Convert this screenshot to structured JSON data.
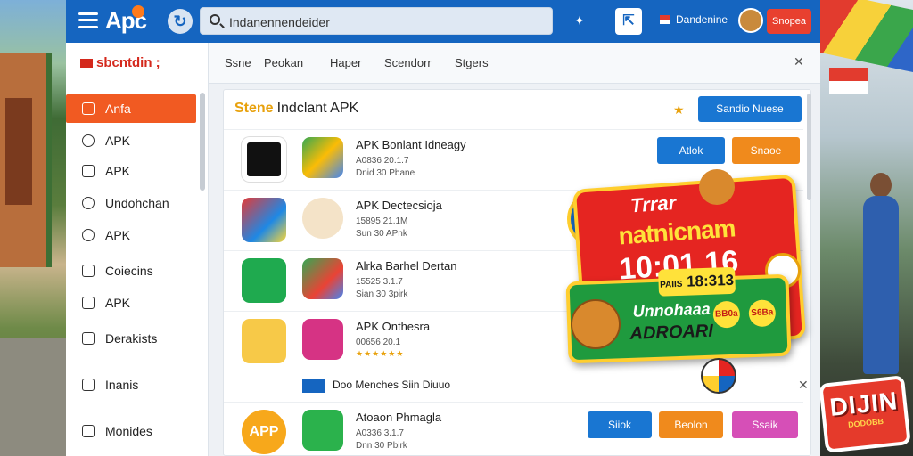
{
  "header": {
    "logo": "Apc",
    "search_text": "Indanennendeider",
    "user_name": "Dandenine",
    "signup_label": "Snopea"
  },
  "sidebar": {
    "brand": "sbcntdin",
    "brand_suffix": ";",
    "items": [
      {
        "label": "Anfa",
        "icon": "grid-icon",
        "active": true
      },
      {
        "label": "APK",
        "icon": "clock-icon"
      },
      {
        "label": "APK",
        "icon": "home-icon"
      },
      {
        "label": "Undohchan",
        "icon": "shield-icon"
      },
      {
        "label": "APK",
        "icon": "refresh-icon"
      },
      {
        "label": "Coiecins",
        "icon": "box-icon"
      },
      {
        "label": "APK",
        "icon": "home-icon"
      },
      {
        "label": "Derakists",
        "icon": "list-icon"
      },
      {
        "label": "Inanis",
        "icon": "table-icon"
      },
      {
        "label": "Monides",
        "icon": "doc-icon"
      }
    ]
  },
  "tabs": [
    {
      "label": "Ssne"
    },
    {
      "label": "Peokan"
    },
    {
      "label": "Haper"
    },
    {
      "label": "Scendorr"
    },
    {
      "label": "Stgers"
    }
  ],
  "panel": {
    "title_tag": "Stene",
    "title": "Indclant APK",
    "action_label": "Sandio Nuese"
  },
  "rows": [
    {
      "name": "APK Bonlant Idneagy",
      "meta1": "A0836 20.1.7",
      "meta2": "Dnid 30 Pbane",
      "buttons": [
        {
          "label": "Atlok",
          "color": "#1976d2"
        },
        {
          "label": "Snaoe",
          "color": "#f08a1c"
        }
      ]
    },
    {
      "name": "APK Dectecsioja",
      "meta1": "15895 21.1M",
      "meta2": "Sun 30 APnk"
    },
    {
      "name": "Alrka Barhel Dertan",
      "meta1": "15525 3.1.7",
      "meta2": "Sian 30 3pirk"
    },
    {
      "name": "APK Onthesra",
      "meta1": "00656 20.1",
      "stars": "★★★★★★"
    },
    {
      "name": "Atoaon Phmagla",
      "meta1": "A0336 3.1.7",
      "meta2": "Dnn 30 Pbirk",
      "buttons": [
        {
          "label": "Siiok",
          "color": "#1976d2"
        },
        {
          "label": "Beolon",
          "color": "#f08a1c"
        },
        {
          "label": "Ssaik",
          "color": "#d64fb7"
        }
      ]
    }
  ],
  "notice": {
    "text": "Doo Menches Siin Diuuo"
  },
  "promo": {
    "line1": "Trrar",
    "line2": "natnicnam",
    "line3": "10:01.16",
    "time_prefix": "PAIIS",
    "time": "18:313",
    "word1": "Unnohaaa",
    "word2": "ADROARI",
    "circle1": "BB0a",
    "circle2": "S6Ba"
  },
  "sticker": {
    "big": "DIJIN",
    "small": "DODOBB"
  },
  "colors": {
    "topbar": "#1565c0",
    "accent_orange": "#f15a22",
    "promo_red": "#e52521",
    "promo_yellow": "#ffce2e"
  }
}
